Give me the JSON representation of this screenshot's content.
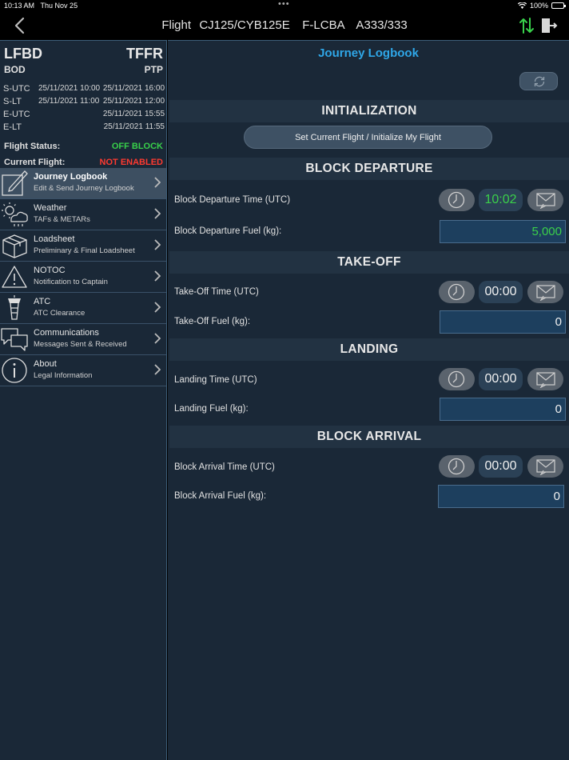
{
  "status_bar": {
    "time": "10:13 AM",
    "date": "Thu Nov 25",
    "battery": "100%"
  },
  "nav": {
    "title": "Flight  CJ125/CYB125E   F-LCBA   A333/333"
  },
  "sidebar": {
    "origin": "LFBD",
    "destination": "TFFR",
    "origin_iata": "BOD",
    "destination_iata": "PTP",
    "times": [
      {
        "label": "S-UTC",
        "dep": "25/11/2021 10:00",
        "arr": "25/11/2021 16:00"
      },
      {
        "label": "S-LT",
        "dep": "25/11/2021 11:00",
        "arr": "25/11/2021 12:00"
      },
      {
        "label": "E-UTC",
        "dep": "",
        "arr": "25/11/2021 15:55"
      },
      {
        "label": "E-LT",
        "dep": "",
        "arr": "25/11/2021 11:55"
      }
    ],
    "flight_status_label": "Flight Status:",
    "flight_status_value": "OFF BLOCK",
    "current_flight_label": "Current Flight:",
    "current_flight_value": "NOT ENABLED",
    "menu": [
      {
        "title": "Journey Logbook",
        "subtitle": "Edit & Send Journey Logbook",
        "icon": "edit-icon"
      },
      {
        "title": "Weather",
        "subtitle": "TAFs & METARs",
        "icon": "weather-icon"
      },
      {
        "title": "Loadsheet",
        "subtitle": "Preliminary & Final Loadsheet",
        "icon": "box-icon"
      },
      {
        "title": "NOTOC",
        "subtitle": "Notification to Captain",
        "icon": "warning-icon"
      },
      {
        "title": "ATC",
        "subtitle": "ATC Clearance",
        "icon": "tower-icon"
      },
      {
        "title": "Communications",
        "subtitle": "Messages Sent & Received",
        "icon": "chat-icon"
      },
      {
        "title": "About",
        "subtitle": "Legal Information",
        "icon": "info-icon"
      }
    ]
  },
  "main": {
    "title": "Journey Logbook",
    "initialization": {
      "header": "INITIALIZATION",
      "button": "Set Current Flight / Initialize My Flight"
    },
    "block_departure": {
      "header": "BLOCK DEPARTURE",
      "time_label": "Block Departure Time (UTC)",
      "time": "10:02",
      "fuel_label": "Block Departure Fuel (kg):",
      "fuel": "5,000"
    },
    "takeoff": {
      "header": "TAKE-OFF",
      "time_label": "Take-Off Time (UTC)",
      "time": "00:00",
      "fuel_label": "Take-Off Fuel (kg):",
      "fuel": "0"
    },
    "landing": {
      "header": "LANDING",
      "time_label": "Landing Time (UTC)",
      "time": "00:00",
      "fuel_label": "Landing Fuel (kg):",
      "fuel": "0"
    },
    "block_arrival": {
      "header": "BLOCK ARRIVAL",
      "time_label": "Block Arrival Time (UTC)",
      "time": "00:00",
      "fuel_label": "Block Arrival Fuel (kg):",
      "fuel": "0"
    }
  },
  "colors": {
    "accent": "#2fa7e8",
    "ok": "#38d04a",
    "alert": "#ff3a30",
    "panel": "#1a2837"
  }
}
